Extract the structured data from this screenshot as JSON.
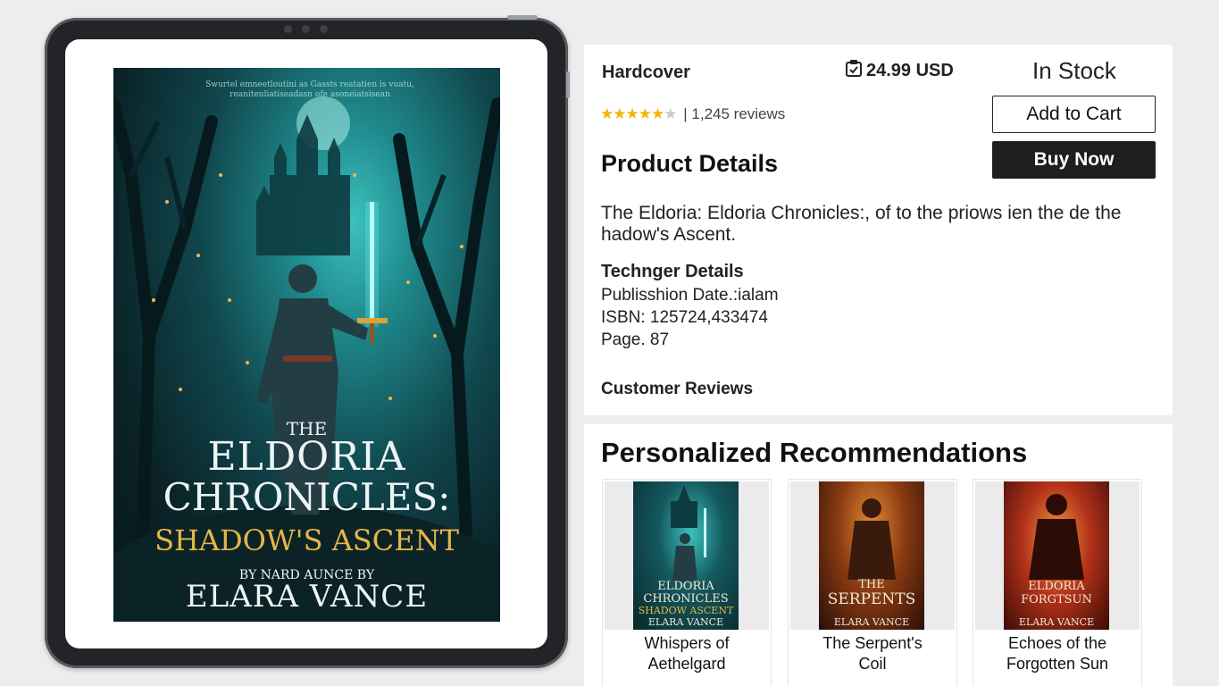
{
  "product": {
    "format": "Hardcover",
    "price": "24.99 USD",
    "price_icon": "tag-icon",
    "stock": "In Stock",
    "rating_value": 4.5,
    "rating_max": 5,
    "review_count": "1,245 reviews",
    "add_to_cart_label": "Add to Cart",
    "buy_now_label": "Buy Now"
  },
  "details": {
    "heading": "Product Details",
    "description": "The Eldoria: Eldoria Chronicles:, of to the priows ien the de the hadow's Ascent.",
    "tech_heading": "Technger Details",
    "publication": "Publisshion Date.:ialam",
    "isbn": "ISBN: 125724,433474",
    "pages": "Page. 87",
    "reviews_heading": "Customer Reviews"
  },
  "cover": {
    "tagline": "Swurtel emneetloutini as Gassts reatatien is vuatu, reaniteuliatiseadasn ofe asoneiatsisean",
    "title_the": "THE",
    "title_line1": "ELDORIA",
    "title_line2": "CHRONICLES:",
    "title_line3": "SHADOW'S ASCENT",
    "by_line": "BY NARD AUNCE BY",
    "author": "ELARA VANCE"
  },
  "recommendations": {
    "heading": "Personalized Recommendations",
    "items": [
      {
        "title_line1": "Whispers of",
        "title_line2": "Aethelgard",
        "cover_line1": "ELDORIA",
        "cover_line2": "CHRONICLES",
        "cover_line3": "SHADOW ASCENT",
        "cover_author": "ELARA VANCE"
      },
      {
        "title_line1": "The Serpent's",
        "title_line2": "Coil",
        "cover_line1": "THE",
        "cover_line2": "SERPENTS",
        "cover_line3": "",
        "cover_author": "ELARA VANCE"
      },
      {
        "title_line1": "Echoes of the",
        "title_line2": "Forgotten Sun",
        "cover_line1": "ELDORIA",
        "cover_line2": "FORGTSUN",
        "cover_line3": "",
        "cover_author": "ELARA VANCE"
      }
    ]
  },
  "colors": {
    "star": "#f2b705",
    "buy_button": "#1e1e1e",
    "cover_teal": "#1f8a8d",
    "cover_gold": "#e6b64a"
  }
}
